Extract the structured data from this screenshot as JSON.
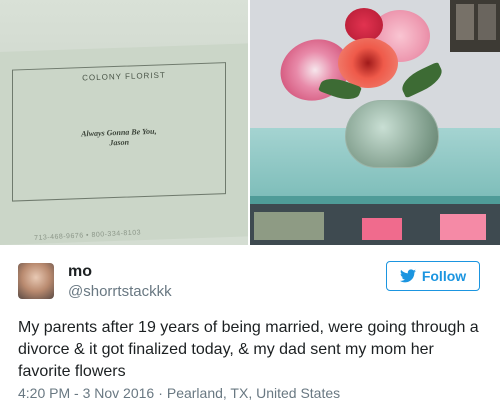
{
  "card": {
    "brand": "COLONY FLORIST",
    "message_line1": "Always Gonna Be You,",
    "message_line2": "Jason",
    "phone": "713-468-9676  •  800-334-8103"
  },
  "tweet": {
    "display_name": "mo",
    "handle": "@shorrtstackkk",
    "follow_label": "Follow",
    "text": "My parents after 19 years of being married, were going through a divorce & it got finalized today, & my dad sent my mom her favorite flowers",
    "timestamp": "4:20 PM - 3 Nov 2016",
    "separator": "·",
    "location": "Pearland, TX, United States"
  },
  "icons": {
    "follow": "twitter-bird-icon",
    "avatar": "avatar"
  },
  "colors": {
    "accent": "#1b95e0",
    "text": "#1c2022",
    "muted": "#697882"
  }
}
